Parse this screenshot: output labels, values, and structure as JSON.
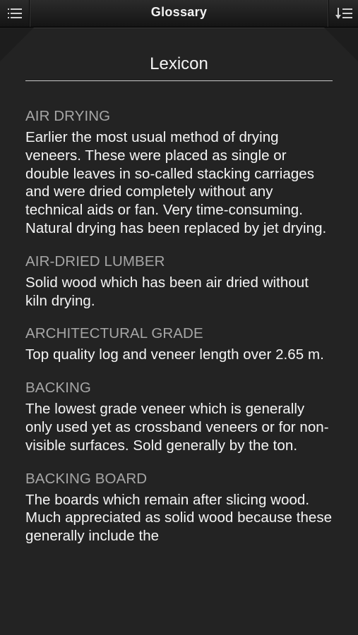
{
  "navbar": {
    "title": "Glossary",
    "menu_icon": "list-menu-icon",
    "sort_icon": "sort-list-icon"
  },
  "section": {
    "title": "Lexicon"
  },
  "entries": [
    {
      "term": "AIR DRYING",
      "definition": "Earlier the most usual method of drying veneers. These were placed as single or double leaves in so-called stacking carriages and were dried completely without any technical aids or fan. Very time-consuming. Natural drying has been replaced by jet drying."
    },
    {
      "term": "AIR-DRIED LUMBER",
      "definition": "Solid wood which has been air dried without kiln drying."
    },
    {
      "term": "ARCHITECTURAL GRADE",
      "definition": "Top quality log and veneer length over 2.65 m."
    },
    {
      "term": "BACKING",
      "definition": "The lowest grade veneer which is generally only used yet as crossband veneers or for non-visible surfaces. Sold generally by the ton."
    },
    {
      "term": "BACKING BOARD",
      "definition": "The boards which remain after slicing wood. Much appreciated as solid wood because these generally include the"
    }
  ],
  "colors": {
    "background": "#232323",
    "term": "#a6a6a6",
    "text": "#f5f5f5"
  }
}
